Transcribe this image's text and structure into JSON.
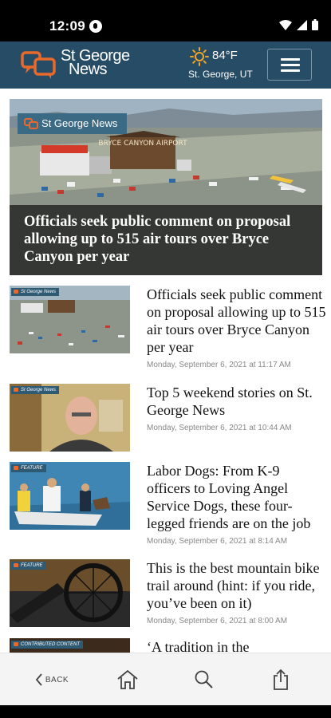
{
  "status_bar": {
    "time": "12:09"
  },
  "header": {
    "logo_line1": "St George",
    "logo_line2": "News",
    "weather_temp": "84°F",
    "weather_location": "St. George, UT"
  },
  "hero": {
    "badge": "St George News",
    "sign_text": "BRYCE CANYON AIRPORT",
    "title": "Officials seek public comment on proposal allowing up to 515 air tours over Bryce Canyon per year"
  },
  "articles": [
    {
      "badge": "St George News",
      "title": "Officials seek public comment on proposal allowing up to 515 air tours over Bryce Canyon per year",
      "date": "Monday, September 6, 2021 at 11:17 AM"
    },
    {
      "badge": "St George News",
      "title": "Top 5 weekend stories on St. George News",
      "date": "Monday, September 6, 2021 at 10:44 AM"
    },
    {
      "badge": "FEATURE",
      "title": "Labor Dogs: From K-9 officers to Loving Angel Service Dogs, these four-legged friends are on the job",
      "date": "Monday, September 6, 2021 at 8:14 AM"
    },
    {
      "badge": "FEATURE",
      "title": "This is the best mountain bike trail around (hint: if you ride, you’ve been on it)",
      "date": "Monday, September 6, 2021 at 8:00 AM"
    },
    {
      "badge": "CONTRIBUTED CONTENT",
      "title": "‘A tradition in the"
    }
  ],
  "bottom_nav": {
    "back_label": "BACK"
  },
  "colors": {
    "header_bg": "#274c66",
    "logo_orange": "#e8692b",
    "nav_bg": "#f4f4f4"
  }
}
